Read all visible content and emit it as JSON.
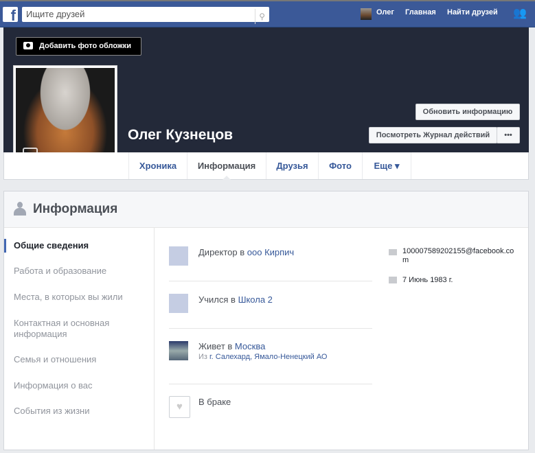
{
  "topbar": {
    "search_placeholder": "Ищите друзей",
    "user": "Олег",
    "home": "Главная",
    "find_friends": "Найти друзей"
  },
  "cover": {
    "add_cover": "Добавить фото обложки",
    "name": "Олег Кузнецов",
    "update_info": "Обновить информацию",
    "activity_log": "Посмотреть Журнал действий",
    "more": "•••"
  },
  "tabs": [
    "Хроника",
    "Информация",
    "Друзья",
    "Фото",
    "Еще ▾"
  ],
  "panel": {
    "title": "Информация",
    "sidebar": [
      "Общие сведения",
      "Работа и образование",
      "Места, в которых вы жили",
      "Контактная и основная информация",
      "Семья и отношения",
      "Информация о вас",
      "События из жизни"
    ],
    "work": {
      "prefix": "Директор в ",
      "link": "ооо Кирпич"
    },
    "school": {
      "prefix": "Учился в ",
      "link": "Школа 2"
    },
    "lives": {
      "prefix": "Живет в ",
      "link": "Москва",
      "from_prefix": "Из ",
      "from_link": "г. Салехард, Ямало-Ненецкий АО"
    },
    "relationship": "В браке",
    "email": "100007589202155@facebook.com",
    "birthday": "7 Июнь 1983 г."
  }
}
